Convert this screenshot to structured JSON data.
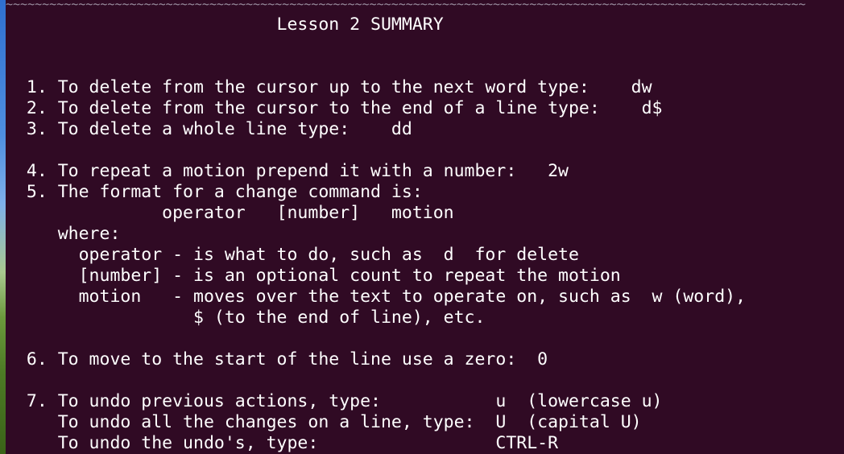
{
  "terminal": {
    "tilde_rule": "~~~~~~~~~~~~~~~~~~~~~~~~~~~~~~~~~~~~~~~~~~~~~~~~~~~~~~~~~~~~~~~~~~~~~~~~~~~~~~~~~~~~~~~~~~~~~~~~~~~~~~~~~~~~~~",
    "lines": [
      "                          Lesson 2 SUMMARY",
      "",
      "",
      "  1. To delete from the cursor up to the next word type:    dw",
      "  2. To delete from the cursor to the end of a line type:    d$",
      "  3. To delete a whole line type:    dd",
      "",
      "  4. To repeat a motion prepend it with a number:   2w",
      "  5. The format for a change command is:",
      "               operator   [number]   motion",
      "     where:",
      "       operator - is what to do, such as  d  for delete",
      "       [number] - is an optional count to repeat the motion",
      "       motion   - moves over the text to operate on, such as  w (word),",
      "                  $ (to the end of line), etc.",
      "",
      "  6. To move to the start of the line use a zero:  0",
      "",
      "  7. To undo previous actions, type:           u  (lowercase u)",
      "     To undo all the changes on a line, type:  U  (capital U)",
      "     To undo the undo's, type:                 CTRL-R"
    ]
  }
}
